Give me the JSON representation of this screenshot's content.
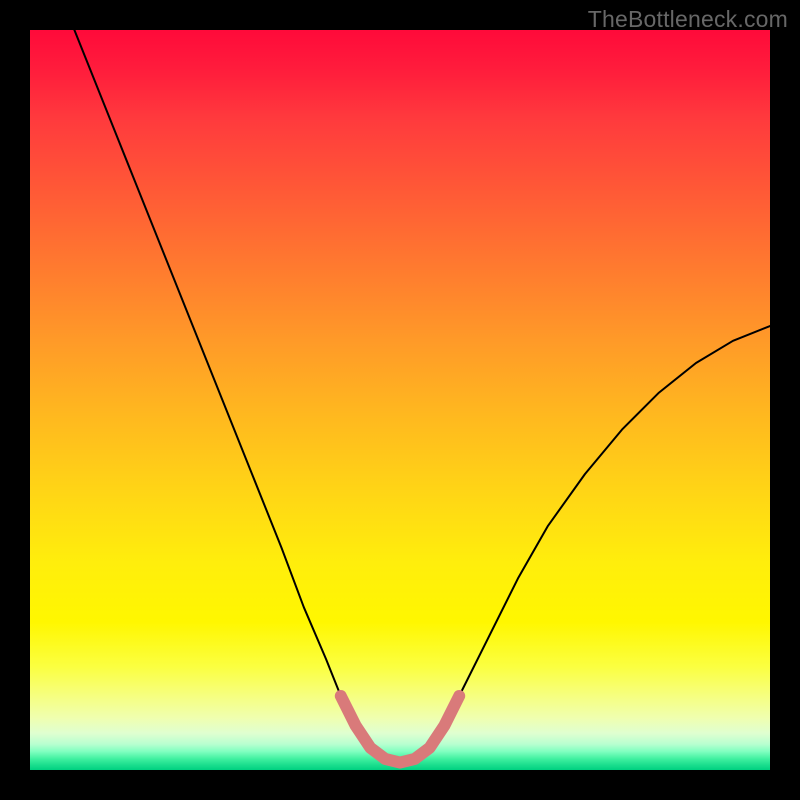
{
  "watermark": "TheBottleneck.com",
  "chart_data": {
    "type": "line",
    "title": "",
    "xlabel": "",
    "ylabel": "",
    "xlim": [
      0,
      100
    ],
    "ylim": [
      0,
      100
    ],
    "grid": false,
    "series": [
      {
        "name": "black-curve",
        "stroke": "#000000",
        "stroke_width": 2,
        "x": [
          6,
          10,
          14,
          18,
          22,
          26,
          30,
          34,
          37,
          40,
          42,
          44,
          46,
          48,
          50,
          52,
          54,
          56,
          58,
          62,
          66,
          70,
          75,
          80,
          85,
          90,
          95,
          100
        ],
        "y": [
          100,
          90,
          80,
          70,
          60,
          50,
          40,
          30,
          22,
          15,
          10,
          6,
          3,
          1.5,
          1,
          1.5,
          3,
          6,
          10,
          18,
          26,
          33,
          40,
          46,
          51,
          55,
          58,
          60
        ]
      },
      {
        "name": "pink-bottom-segment",
        "stroke": "#d97a7a",
        "stroke_width": 12,
        "x": [
          42,
          44,
          46,
          48,
          50,
          52,
          54,
          56,
          58
        ],
        "y": [
          10,
          6,
          3,
          1.5,
          1,
          1.5,
          3,
          6,
          10
        ]
      }
    ],
    "colors": {
      "background_gradient_top": "#ff0a3a",
      "background_gradient_mid": "#ffee0c",
      "background_gradient_bottom": "#00d080",
      "frame": "#000000"
    }
  }
}
